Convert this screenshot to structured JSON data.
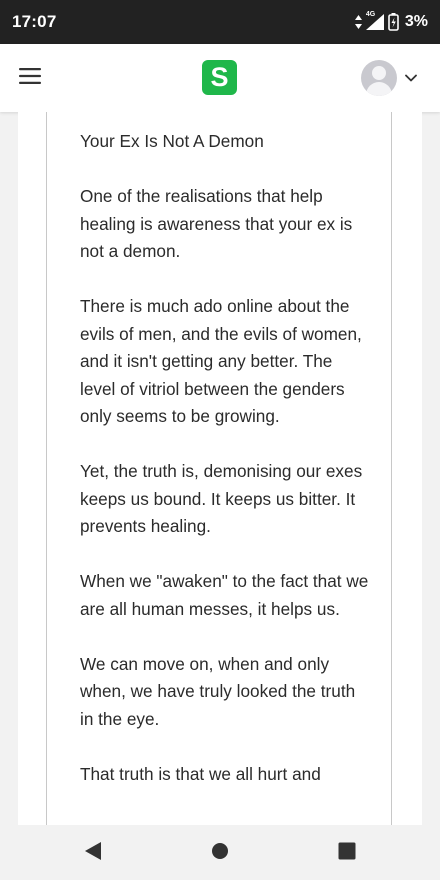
{
  "status_bar": {
    "time": "17:07",
    "network": "4G",
    "battery": "3%"
  },
  "header": {
    "logo_letter": "S",
    "icons": {
      "menu": "hamburger-menu-icon",
      "avatar": "user-avatar-icon",
      "chevron": "chevron-down-icon"
    }
  },
  "article": {
    "title": "Your Ex Is Not A Demon",
    "paragraphs": [
      "One of the realisations that help healing is awareness that your ex is not a demon.",
      "There is much ado online about the evils of men, and the evils of women, and it isn't getting any better. The level of vitriol between the genders only seems to be growing.",
      "Yet, the truth is, demonising our exes keeps us bound. It keeps us bitter. It prevents healing.",
      "When we \"awaken\" to the fact that we are all human messes, it helps us.",
      "We can move on, when and only when, we have truly looked the truth in the eye.",
      "That truth is that we all hurt and"
    ]
  },
  "nav_bar": {
    "icons": [
      "back-triangle-icon",
      "home-circle-icon",
      "recents-square-icon"
    ]
  },
  "colors": {
    "status_bar_bg": "#222222",
    "brand_green": "#1fb74a",
    "text": "#2b2b2b",
    "page_bg": "#f2f2f2"
  }
}
